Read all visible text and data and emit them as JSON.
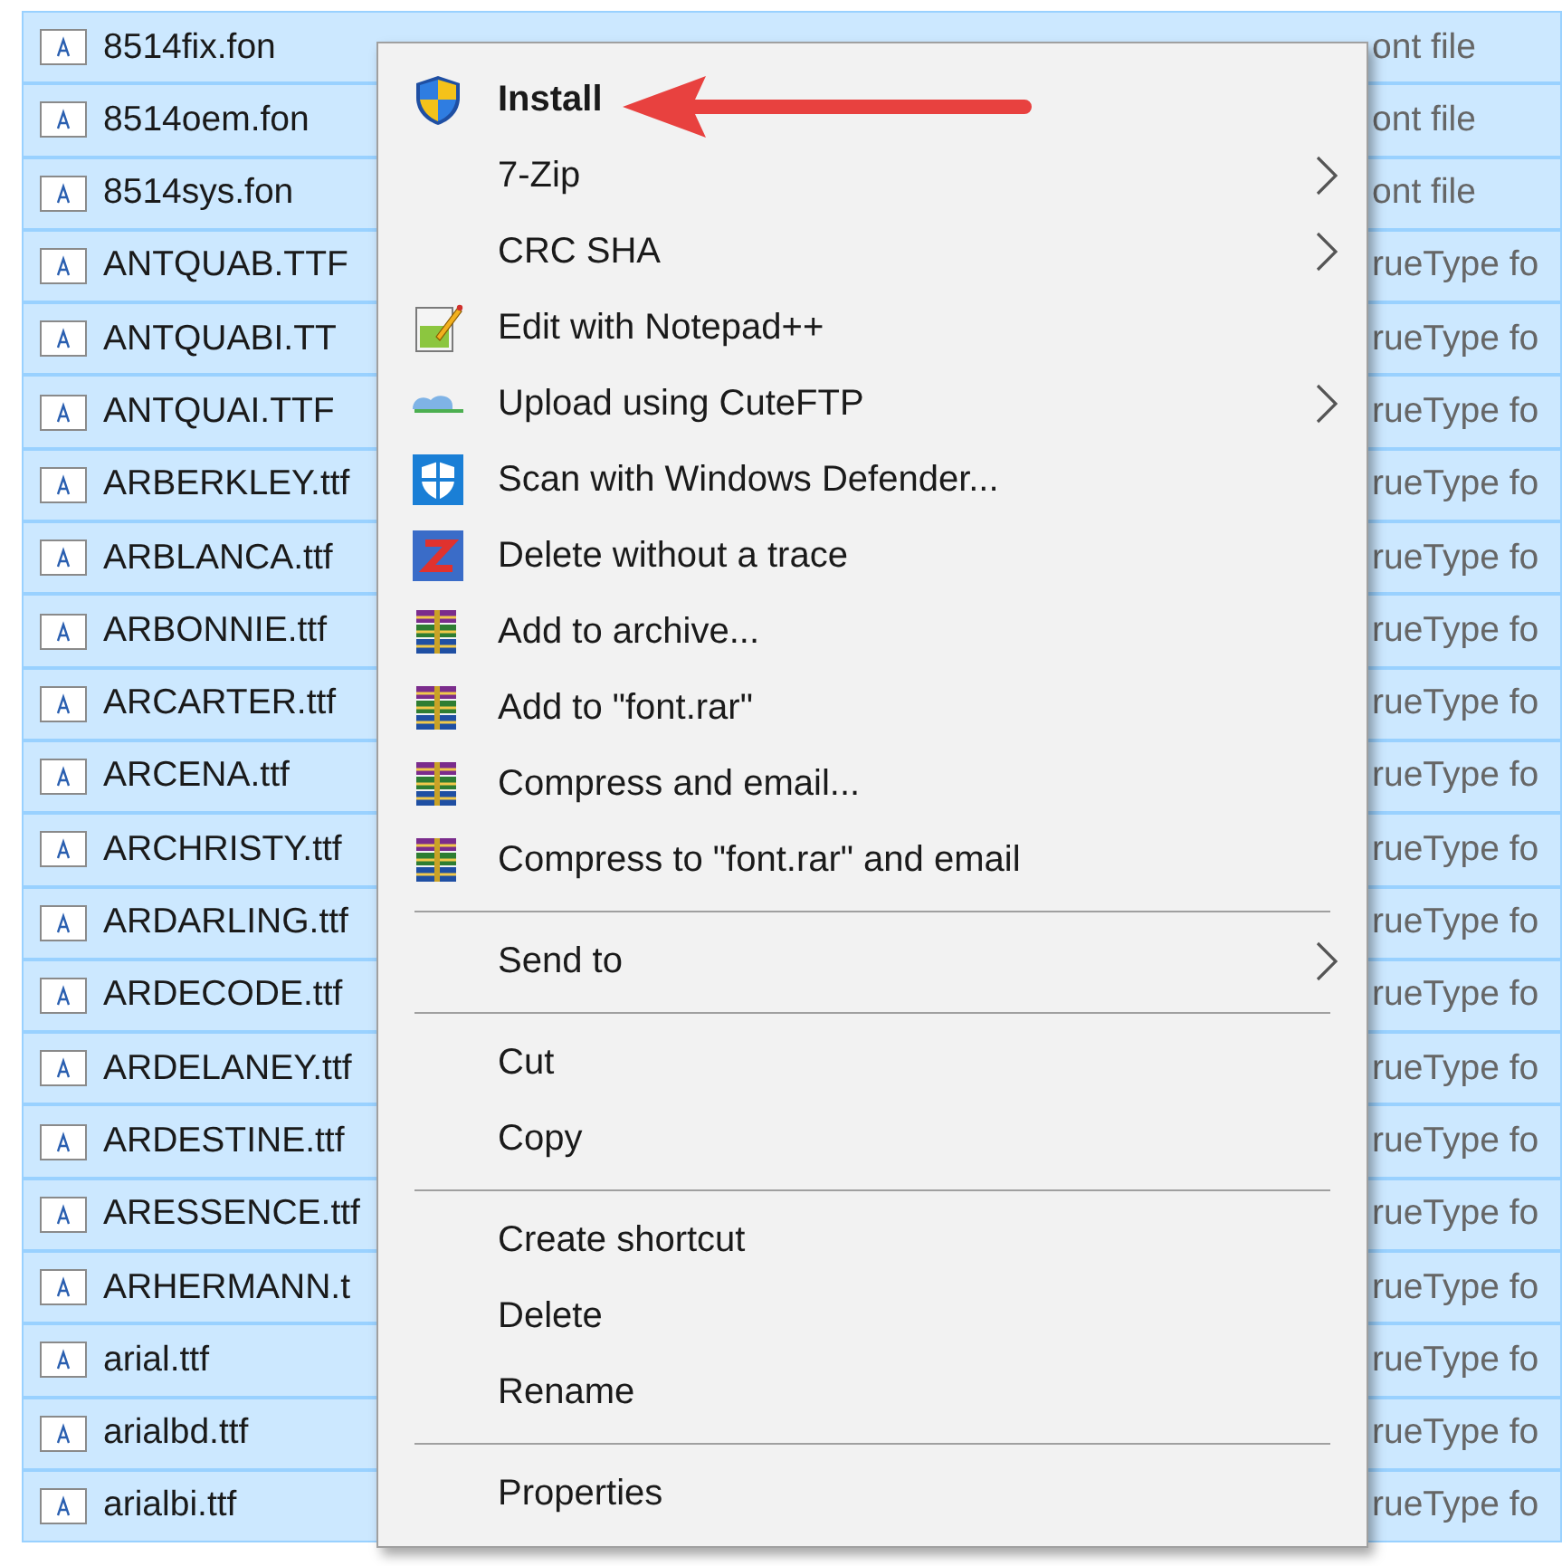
{
  "files": [
    {
      "name": "8514fix.fon",
      "type": "ont file",
      "selected": true
    },
    {
      "name": "8514oem.fon",
      "type": "ont file",
      "selected": true
    },
    {
      "name": "8514sys.fon",
      "type": "ont file",
      "selected": true
    },
    {
      "name": "ANTQUAB.TTF",
      "type": "rueType fo",
      "selected": true
    },
    {
      "name": "ANTQUABI.TT",
      "type": "rueType fo",
      "selected": true
    },
    {
      "name": "ANTQUAI.TTF",
      "type": "rueType fo",
      "selected": true
    },
    {
      "name": "ARBERKLEY.ttf",
      "type": "rueType fo",
      "selected": true
    },
    {
      "name": "ARBLANCA.ttf",
      "type": "rueType fo",
      "selected": true
    },
    {
      "name": "ARBONNIE.ttf",
      "type": "rueType fo",
      "selected": true
    },
    {
      "name": "ARCARTER.ttf",
      "type": "rueType fo",
      "selected": true
    },
    {
      "name": "ARCENA.ttf",
      "type": "rueType fo",
      "selected": true
    },
    {
      "name": "ARCHRISTY.ttf",
      "type": "rueType fo",
      "selected": true
    },
    {
      "name": "ARDARLING.ttf",
      "type": "rueType fo",
      "selected": true
    },
    {
      "name": "ARDECODE.ttf",
      "type": "rueType fo",
      "selected": true
    },
    {
      "name": "ARDELANEY.ttf",
      "type": "rueType fo",
      "selected": true
    },
    {
      "name": "ARDESTINE.ttf",
      "type": "rueType fo",
      "selected": true
    },
    {
      "name": "ARESSENCE.ttf",
      "type": "rueType fo",
      "selected": true
    },
    {
      "name": "ARHERMANN.t",
      "type": "rueType fo",
      "selected": true
    },
    {
      "name": "arial.ttf",
      "type": "rueType fo",
      "selected": true
    },
    {
      "name": "arialbd.ttf",
      "type": "rueType fo",
      "selected": true
    },
    {
      "name": "arialbi.ttf",
      "type": "rueType fo",
      "selected": true
    }
  ],
  "context_menu": [
    {
      "kind": "shield",
      "label": "Install",
      "default": true,
      "submenu": false
    },
    {
      "kind": "plain",
      "label": "7-Zip",
      "default": false,
      "submenu": true
    },
    {
      "kind": "plain",
      "label": "CRC SHA",
      "default": false,
      "submenu": true
    },
    {
      "kind": "notepad",
      "label": "Edit with Notepad++",
      "default": false,
      "submenu": false
    },
    {
      "kind": "upload",
      "label": "Upload using CuteFTP",
      "default": false,
      "submenu": true
    },
    {
      "kind": "defender",
      "label": "Scan with Windows Defender...",
      "default": false,
      "submenu": false
    },
    {
      "kind": "shredder",
      "label": "Delete without a trace",
      "default": false,
      "submenu": false
    },
    {
      "kind": "archive",
      "label": "Add to archive...",
      "default": false,
      "submenu": false
    },
    {
      "kind": "archive",
      "label": "Add to \"font.rar\"",
      "default": false,
      "submenu": false
    },
    {
      "kind": "archive",
      "label": "Compress and email...",
      "default": false,
      "submenu": false
    },
    {
      "kind": "archive",
      "label": "Compress to \"font.rar\" and email",
      "default": false,
      "submenu": false
    },
    {
      "kind": "separator"
    },
    {
      "kind": "plain",
      "label": "Send to",
      "default": false,
      "submenu": true
    },
    {
      "kind": "separator"
    },
    {
      "kind": "plain",
      "label": "Cut",
      "default": false,
      "submenu": false
    },
    {
      "kind": "plain",
      "label": "Copy",
      "default": false,
      "submenu": false
    },
    {
      "kind": "separator"
    },
    {
      "kind": "plain",
      "label": "Create shortcut",
      "default": false,
      "submenu": false
    },
    {
      "kind": "plain",
      "label": "Delete",
      "default": false,
      "submenu": false
    },
    {
      "kind": "plain",
      "label": "Rename",
      "default": false,
      "submenu": false
    },
    {
      "kind": "separator"
    },
    {
      "kind": "plain",
      "label": "Properties",
      "default": false,
      "submenu": false
    }
  ]
}
